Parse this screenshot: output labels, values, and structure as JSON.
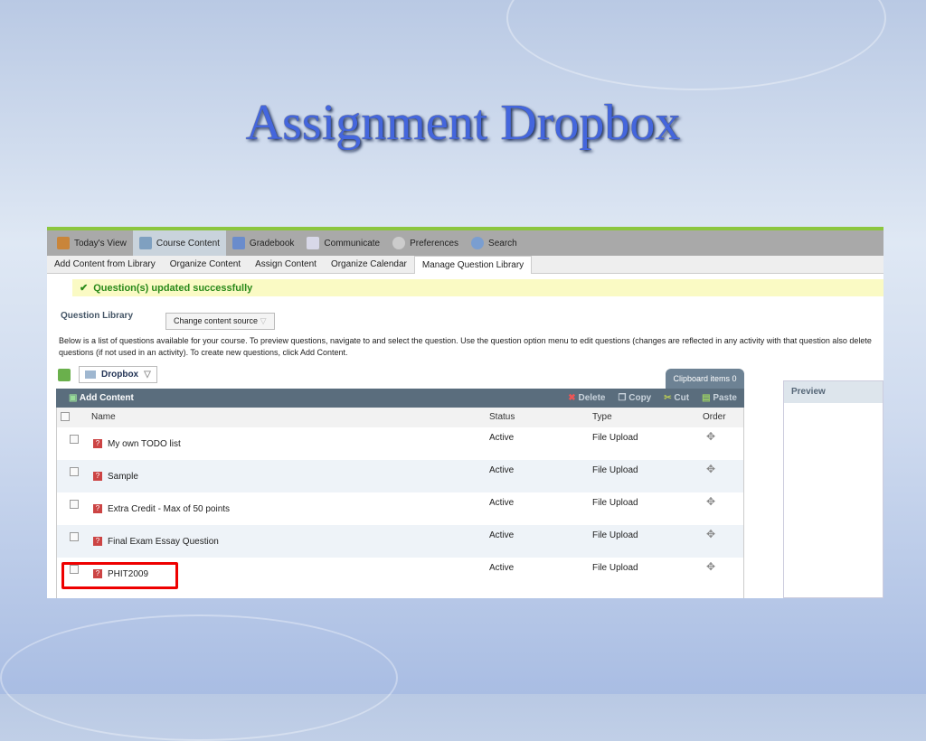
{
  "slide_title": "Assignment Dropbox",
  "nav": [
    "Today's View",
    "Course Content",
    "Gradebook",
    "Communicate",
    "Preferences",
    "Search"
  ],
  "subnav": [
    "Add Content from Library",
    "Organize Content",
    "Assign Content",
    "Organize Calendar",
    "Manage Question Library"
  ],
  "banner": "Question(s) updated successfully",
  "question_library_label": "Question Library",
  "change_source": "Change content source",
  "desc1": "Below is a list of questions available for your course. To preview questions, navigate to and select the question. Use the question option menu to edit questions (changes are reflected in any activity with that question",
  "desc2": "also delete questions (if not used in an activity). To create new questions, click Add Content.",
  "folder": "Dropbox",
  "clipboard": "Clipboard items 0",
  "add_content": "Add Content",
  "actions": [
    "Delete",
    "Copy",
    "Cut",
    "Paste"
  ],
  "columns": [
    "Name",
    "Status",
    "Type",
    "Order"
  ],
  "rows": [
    {
      "name": "My own TODO list",
      "status": "Active",
      "type": "File Upload"
    },
    {
      "name": "Sample",
      "status": "Active",
      "type": "File Upload"
    },
    {
      "name": "Extra Credit - Max of 50 points",
      "status": "Active",
      "type": "File Upload"
    },
    {
      "name": "Final Exam Essay Question",
      "status": "Active",
      "type": "File Upload"
    },
    {
      "name": "PHIT2009",
      "status": "Active",
      "type": "File Upload"
    }
  ],
  "preview": "Preview",
  "colors": {
    "nav": "#a9a9a9",
    "accent": "#8cc63f",
    "toolbar": "#5a6d7d",
    "highlight": "#ee0000"
  }
}
